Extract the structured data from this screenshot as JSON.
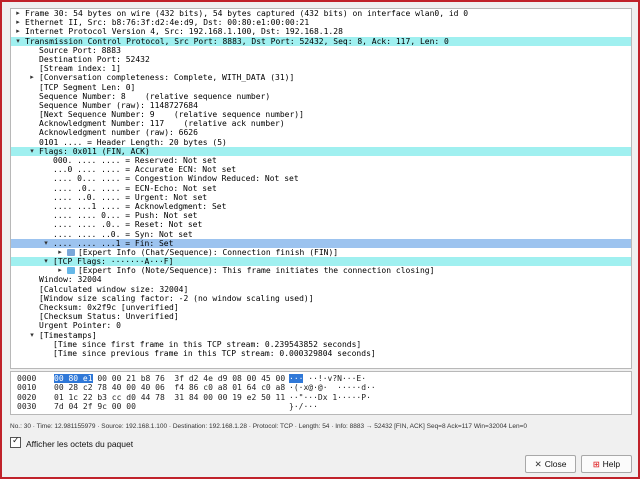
{
  "packet_tree": [
    {
      "text": "Frame 30: 54 bytes on wire (432 bits), 54 bytes captured (432 bits) on interface wlan0, id 0",
      "level": 0,
      "arrow": "right",
      "hl": "",
      "name": "tree-frame"
    },
    {
      "text": "Ethernet II, Src: b8:76:3f:d2:4e:d9, Dst: 00:80:e1:00:00:21",
      "level": 0,
      "arrow": "right",
      "hl": "",
      "name": "tree-ethernet"
    },
    {
      "text": "Internet Protocol Version 4, Src: 192.168.1.100, Dst: 192.168.1.28",
      "level": 0,
      "arrow": "right",
      "hl": "",
      "name": "tree-ipv4"
    },
    {
      "text": "Transmission Control Protocol, Src Port: 8883, Dst Port: 52432, Seq: 8, Ack: 117, Len: 0",
      "level": 0,
      "arrow": "down",
      "hl": "cyan",
      "name": "tree-tcp"
    },
    {
      "text": "Source Port: 8883",
      "level": 1,
      "arrow": "",
      "hl": "",
      "name": "tree-field"
    },
    {
      "text": "Destination Port: 52432",
      "level": 1,
      "arrow": "",
      "hl": "",
      "name": "tree-field"
    },
    {
      "text": "[Stream index: 1]",
      "level": 1,
      "arrow": "",
      "hl": "",
      "name": "tree-field"
    },
    {
      "text": "[Conversation completeness: Complete, WITH_DATA (31)]",
      "level": 1,
      "arrow": "right",
      "hl": "",
      "name": "tree-field"
    },
    {
      "text": "[TCP Segment Len: 0]",
      "level": 1,
      "arrow": "",
      "hl": "",
      "name": "tree-field"
    },
    {
      "text": "Sequence Number: 8    (relative sequence number)",
      "level": 1,
      "arrow": "",
      "hl": "",
      "name": "tree-field"
    },
    {
      "text": "Sequence Number (raw): 1148727684",
      "level": 1,
      "arrow": "",
      "hl": "",
      "name": "tree-field"
    },
    {
      "text": "[Next Sequence Number: 9    (relative sequence number)]",
      "level": 1,
      "arrow": "",
      "hl": "",
      "name": "tree-field"
    },
    {
      "text": "Acknowledgment Number: 117    (relative ack number)",
      "level": 1,
      "arrow": "",
      "hl": "",
      "name": "tree-field"
    },
    {
      "text": "Acknowledgment number (raw): 6626",
      "level": 1,
      "arrow": "",
      "hl": "",
      "name": "tree-field"
    },
    {
      "text": "0101 .... = Header Length: 20 bytes (5)",
      "level": 1,
      "arrow": "",
      "hl": "",
      "name": "tree-field"
    },
    {
      "text": "Flags: 0x011 (FIN, ACK)",
      "level": 1,
      "arrow": "down",
      "hl": "cyan",
      "name": "tree-flags"
    },
    {
      "text": "000. .... .... = Reserved: Not set",
      "level": 2,
      "arrow": "",
      "hl": "",
      "name": "tree-flag-bit"
    },
    {
      "text": "...0 .... .... = Accurate ECN: Not set",
      "level": 2,
      "arrow": "",
      "hl": "",
      "name": "tree-flag-bit"
    },
    {
      "text": ".... 0... .... = Congestion Window Reduced: Not set",
      "level": 2,
      "arrow": "",
      "hl": "",
      "name": "tree-flag-bit"
    },
    {
      "text": ".... .0.. .... = ECN-Echo: Not set",
      "level": 2,
      "arrow": "",
      "hl": "",
      "name": "tree-flag-bit"
    },
    {
      "text": ".... ..0. .... = Urgent: Not set",
      "level": 2,
      "arrow": "",
      "hl": "",
      "name": "tree-flag-bit"
    },
    {
      "text": ".... ...1 .... = Acknowledgment: Set",
      "level": 2,
      "arrow": "",
      "hl": "",
      "name": "tree-flag-bit"
    },
    {
      "text": ".... .... 0... = Push: Not set",
      "level": 2,
      "arrow": "",
      "hl": "",
      "name": "tree-flag-bit"
    },
    {
      "text": ".... .... .0.. = Reset: Not set",
      "level": 2,
      "arrow": "",
      "hl": "",
      "name": "tree-flag-bit"
    },
    {
      "text": ".... .... ..0. = Syn: Not set",
      "level": 2,
      "arrow": "",
      "hl": "",
      "name": "tree-flag-bit"
    },
    {
      "text": ".... .... ...1 = Fin: Set",
      "level": 2,
      "arrow": "down",
      "hl": "sel",
      "name": "tree-fin-flag"
    },
    {
      "text": "[Expert Info (Chat/Sequence): Connection finish (FIN)]",
      "level": 3,
      "arrow": "right",
      "hl": "",
      "icon": "expert-chat",
      "name": "tree-expert-info"
    },
    {
      "text": "[TCP Flags: ·······A···F]",
      "level": 2,
      "arrow": "down",
      "hl": "cyan",
      "name": "tree-tcp-flags"
    },
    {
      "text": "[Expert Info (Note/Sequence): This frame initiates the connection closing]",
      "level": 3,
      "arrow": "right",
      "hl": "",
      "icon": "expert-note",
      "name": "tree-expert-info"
    },
    {
      "text": "Window: 32004",
      "level": 1,
      "arrow": "",
      "hl": "",
      "name": "tree-field"
    },
    {
      "text": "[Calculated window size: 32004]",
      "level": 1,
      "arrow": "",
      "hl": "",
      "name": "tree-field"
    },
    {
      "text": "[Window size scaling factor: -2 (no window scaling used)]",
      "level": 1,
      "arrow": "",
      "hl": "",
      "name": "tree-field"
    },
    {
      "text": "Checksum: 0x2f9c [unverified]",
      "level": 1,
      "arrow": "",
      "hl": "",
      "name": "tree-field"
    },
    {
      "text": "[Checksum Status: Unverified]",
      "level": 1,
      "arrow": "",
      "hl": "",
      "name": "tree-field"
    },
    {
      "text": "Urgent Pointer: 0",
      "level": 1,
      "arrow": "",
      "hl": "",
      "name": "tree-field"
    },
    {
      "text": "[Timestamps]",
      "level": 1,
      "arrow": "down",
      "hl": "",
      "name": "tree-timestamps"
    },
    {
      "text": "[Time since first frame in this TCP stream: 0.239543852 seconds]",
      "level": 2,
      "arrow": "",
      "hl": "",
      "name": "tree-field"
    },
    {
      "text": "[Time since previous frame in this TCP stream: 0.000329804 seconds]",
      "level": 2,
      "arrow": "",
      "hl": "",
      "name": "tree-field"
    }
  ],
  "hex_dump": [
    {
      "offset": "0000",
      "sel": "00 80 e1",
      "hex": " 00 00 21 b8 76  3f d2 4e d9 08 00 45 00",
      "asc_sel": "···",
      "asc": " ··!·v?N···E·"
    },
    {
      "offset": "0010",
      "sel": "",
      "hex": "00 28 c2 78 40 00 40 06  f4 86 c0 a8 01 64 c0 a8",
      "asc_sel": "",
      "asc": "·(·x@·@·  ·····d··"
    },
    {
      "offset": "0020",
      "sel": "",
      "hex": "01 1c 22 b3 cc d0 44 78  31 84 00 00 19 e2 50 11",
      "asc_sel": "",
      "asc": "··\"···Dx 1·····P·"
    },
    {
      "offset": "0030",
      "sel": "",
      "hex": "7d 04 2f 9c 00 00",
      "asc_sel": "",
      "asc": "}·/···"
    }
  ],
  "status_text": "No.: 30 · Time: 12.981155979 · Source: 192.168.1.100 · Destination: 192.168.1.28 · Protocol: TCP · Length: 54 · Info: 8883 → 52432 [FIN, ACK] Seq=8 Ack=117 Win=32004 Len=0",
  "show_bytes_label": "Afficher les octets du paquet",
  "buttons": {
    "close_label": "Close",
    "close_icon": "✕",
    "help_label": "Help",
    "help_icon": "⊞"
  },
  "colors": {
    "window_border": "#c0222a",
    "highlight_cyan": "#a0f0f0",
    "selected_row": "#9cc3ef",
    "selected_bytes": "#2f78d8",
    "expert_chat": "#7aa7d9",
    "expert_note": "#66b8e8"
  }
}
